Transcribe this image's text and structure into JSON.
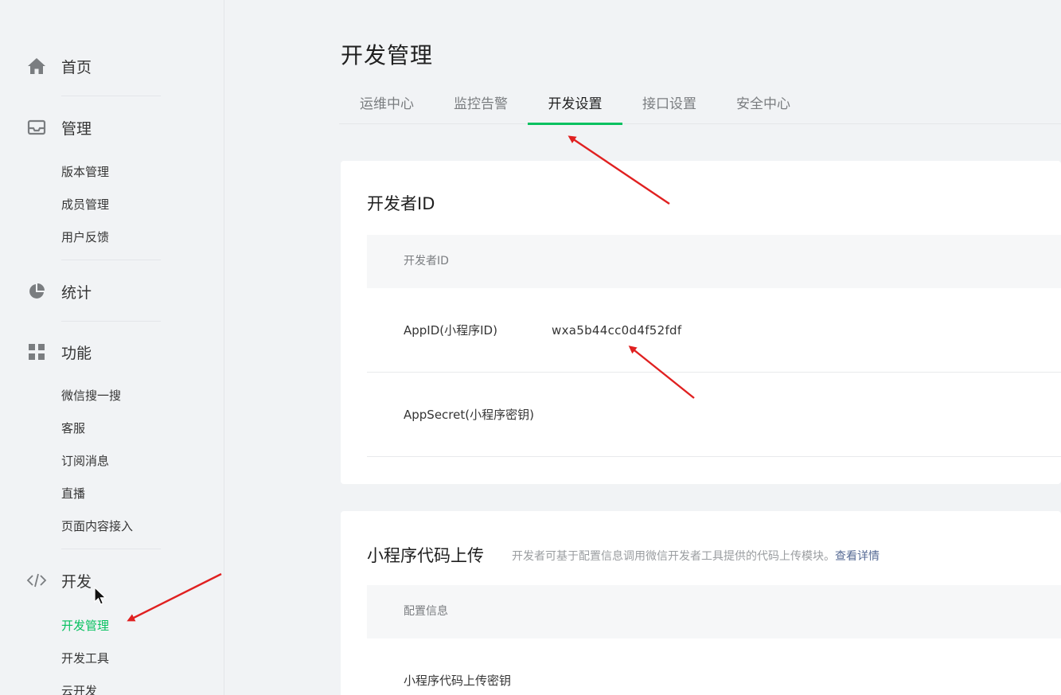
{
  "sidebar": {
    "home": {
      "label": "首页",
      "icon": "home-icon"
    },
    "manage": {
      "label": "管理",
      "icon": "inbox-icon",
      "items": [
        "版本管理",
        "成员管理",
        "用户反馈"
      ]
    },
    "stats": {
      "label": "统计",
      "icon": "pie-chart-icon"
    },
    "features": {
      "label": "功能",
      "icon": "grid-icon",
      "items": [
        "微信搜一搜",
        "客服",
        "订阅消息",
        "直播",
        "页面内容接入"
      ]
    },
    "develop": {
      "label": "开发",
      "icon": "code-icon",
      "items": [
        "开发管理",
        "开发工具",
        "云开发"
      ],
      "active_index": 0
    }
  },
  "page": {
    "title": "开发管理"
  },
  "tabs": {
    "items": [
      "运维中心",
      "监控告警",
      "开发设置",
      "接口设置",
      "安全中心"
    ],
    "active_index": 2
  },
  "developer_id": {
    "title": "开发者ID",
    "table_header": "开发者ID",
    "rows": [
      {
        "label": "AppID(小程序ID)",
        "value": "wxa5b44cc0d4f52fdf"
      },
      {
        "label": "AppSecret(小程序密钥)",
        "value": ""
      }
    ]
  },
  "code_upload": {
    "title": "小程序代码上传",
    "description": "开发者可基于配置信息调用微信开发者工具提供的代码上传模块。",
    "link_text": "查看详情",
    "table_header": "配置信息",
    "rows": [
      {
        "label": "小程序代码上传密钥"
      }
    ]
  },
  "colors": {
    "accent": "#07c160",
    "link": "#576b95",
    "annotation": "#e02020"
  }
}
